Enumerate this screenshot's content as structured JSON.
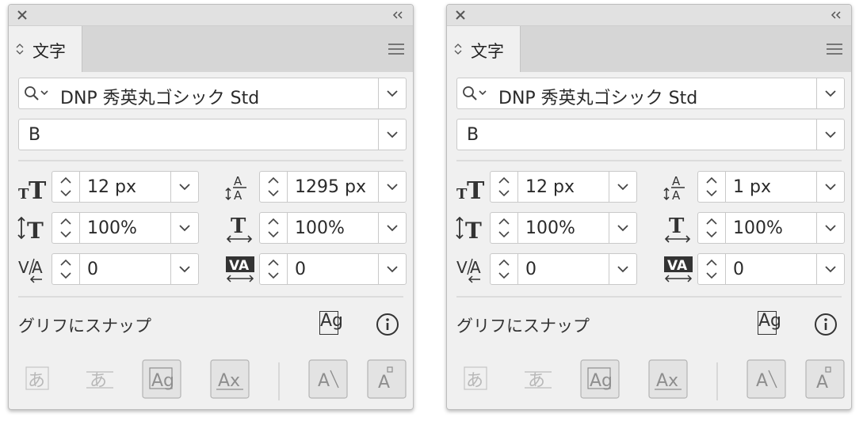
{
  "panels": [
    {
      "tab_label": "文字",
      "font_family": "DNP 秀英丸ゴシック Std",
      "font_style": "B",
      "font_size": "12 px",
      "leading": "1295 px",
      "vertical_scale": "100%",
      "horizontal_scale": "100%",
      "kerning": "0",
      "tracking": "0",
      "snap_label": "グリフにスナップ",
      "snap_icon_text": "Ag"
    },
    {
      "tab_label": "文字",
      "font_family": "DNP 秀英丸ゴシック Std",
      "font_style": "B",
      "font_size": "12 px",
      "leading": "1 px",
      "vertical_scale": "100%",
      "horizontal_scale": "100%",
      "kerning": "0",
      "tracking": "0",
      "snap_label": "グリフにスナップ",
      "snap_icon_text": "Ag"
    }
  ],
  "bottom_buttons": [
    {
      "glyph": "あ",
      "icon": "hiragana-icon",
      "state": "disabled"
    },
    {
      "glyph": "あ",
      "icon": "strikethrough-hiragana-icon",
      "state": "disabled"
    },
    {
      "glyph": "Ag",
      "icon": "baseline-snap-icon",
      "state": "normal"
    },
    {
      "glyph": "Ax",
      "icon": "x-height-snap-icon",
      "state": "normal"
    },
    {
      "glyph": "A",
      "icon": "angle-snap-icon",
      "state": "normal"
    },
    {
      "glyph": "A",
      "icon": "anchor-point-snap-icon",
      "state": "normal"
    }
  ],
  "icons": {
    "close": "close-icon",
    "collapse": "collapse-panel-icon",
    "tab_arrows": "expand-collapse-arrows-icon",
    "menu": "panel-menu-icon",
    "search": "search-icon",
    "dropdown": "chevron-down-icon",
    "spinner": "up-down-stepper-icon",
    "font_size": "font-size-icon",
    "leading": "leading-icon",
    "vertical_scale": "vertical-scale-icon",
    "horizontal_scale": "horizontal-scale-icon",
    "kerning": "kerning-icon",
    "tracking": "tracking-icon",
    "info": "info-icon"
  },
  "colors": {
    "panel_bg": "#f0f0f0",
    "titlebar_bg": "#e1e1e1",
    "field_bg": "#ffffff",
    "icon_dark": "#333333",
    "icon_disabled": "#b8b8b8"
  }
}
